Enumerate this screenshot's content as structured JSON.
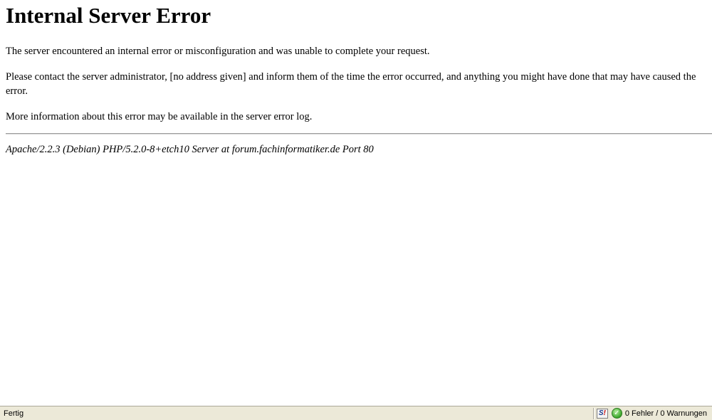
{
  "page": {
    "title": "Internal Server Error",
    "paragraph_1": "The server encountered an internal error or misconfiguration and was unable to complete your request.",
    "paragraph_2_line_1": "Please contact the server administrator, [no address given] and inform them of the time the error occurred, and anything you might have done that may have caused the",
    "paragraph_2_line_2": "error.",
    "paragraph_3": "More information about this error may be available in the server error log.",
    "signature": "Apache/2.2.3 (Debian) PHP/5.2.0-8+etch10 Server at forum.fachinformatiker.de Port 80"
  },
  "statusbar": {
    "status_text": "Fertig",
    "extension_icon": "s-exclaim-icon",
    "extension_icon_letter": "S",
    "extension_icon_mark": "!",
    "validator_icon": "green-check-icon",
    "validator_icon_glyph": "✓",
    "validator_text": "0 Fehler / 0 Warnungen"
  }
}
